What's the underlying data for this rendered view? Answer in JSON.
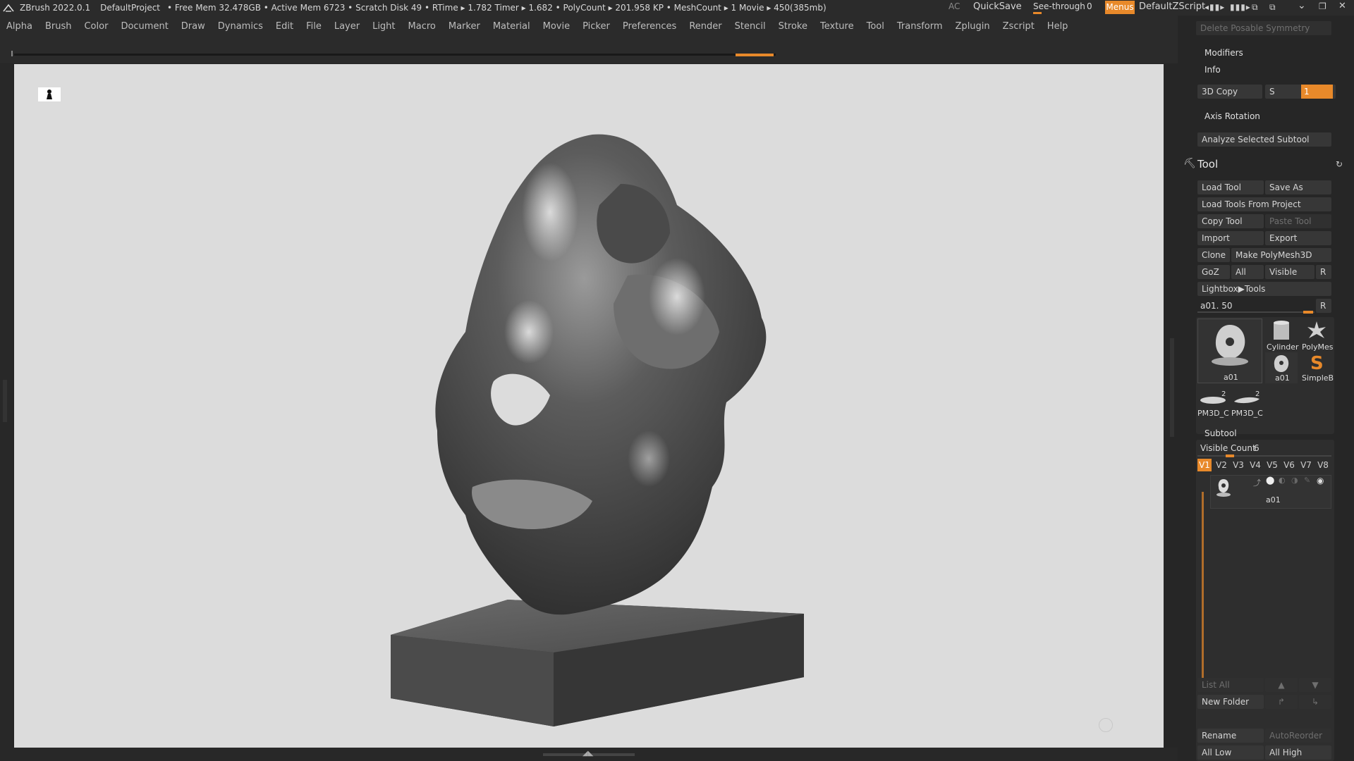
{
  "titlebar": {
    "app": "ZBrush 2022.0.1",
    "project": "DefaultProject",
    "stats": "• Free Mem 32.478GB • Active Mem 6723 • Scratch Disk 49 •  RTime ▸ 1.782 Timer ▸ 1.682 • PolyCount ▸ 201.958 KP  • MeshCount ▸ 1  Movie ▸ 450(385mb)",
    "ac": "AC",
    "quicksave": "QuickSave",
    "seethrough": "See-through",
    "seethrough_value": "0",
    "menus": "Menus",
    "zscript": "DefaultZScript"
  },
  "menubar": [
    "Alpha",
    "Brush",
    "Color",
    "Document",
    "Draw",
    "Dynamics",
    "Edit",
    "File",
    "Layer",
    "Light",
    "Macro",
    "Marker",
    "Material",
    "Movie",
    "Picker",
    "Preferences",
    "Render",
    "Stencil",
    "Stroke",
    "Texture",
    "Tool",
    "Transform",
    "Zplugin",
    "Zscript",
    "Help"
  ],
  "panel": {
    "delete_posable": "Delete Posable Symmetry",
    "modifiers": "Modifiers",
    "info": "Info",
    "copy3d": "3D Copy",
    "s_label": "S",
    "s_value": "1",
    "axis_rotation": "Axis Rotation",
    "analyze": "Analyze Selected Subtool",
    "tool_title": "Tool",
    "load_tool": "Load Tool",
    "save_as": "Save As",
    "load_from_project": "Load Tools From Project",
    "copy_tool": "Copy Tool",
    "paste_tool": "Paste Tool",
    "import": "Import",
    "export": "Export",
    "clone": "Clone",
    "make_polymesh": "Make PolyMesh3D",
    "goz": "GoZ",
    "all": "All",
    "visible": "Visible",
    "r": "R",
    "lightbox_tools": "Lightbox▶Tools",
    "tool_slider_label": "a01. 50",
    "thumbs": {
      "main": "a01",
      "cylinder": "Cylinder",
      "polymesh": "PolyMes",
      "small": "a01",
      "simpleb": "SimpleB",
      "pm1": "PM3D_C",
      "pm2": "PM3D_C",
      "pm_count1": "2",
      "pm_count2": "2"
    },
    "subtool_title": "Subtool",
    "visible_count_label": "Visible Count",
    "visible_count_value": "6",
    "visibility_sets": [
      "V1",
      "V2",
      "V3",
      "V4",
      "V5",
      "V6",
      "V7",
      "V8"
    ],
    "subtool_item": "a01",
    "list_all": "List All",
    "new_folder": "New Folder",
    "rename": "Rename",
    "auto_reorder": "AutoReorder",
    "all_low": "All Low",
    "all_high": "All High"
  },
  "colors": {
    "accent": "#e8892a",
    "viewport_bg": "#dcdcdc",
    "ui_bg": "#262626"
  }
}
